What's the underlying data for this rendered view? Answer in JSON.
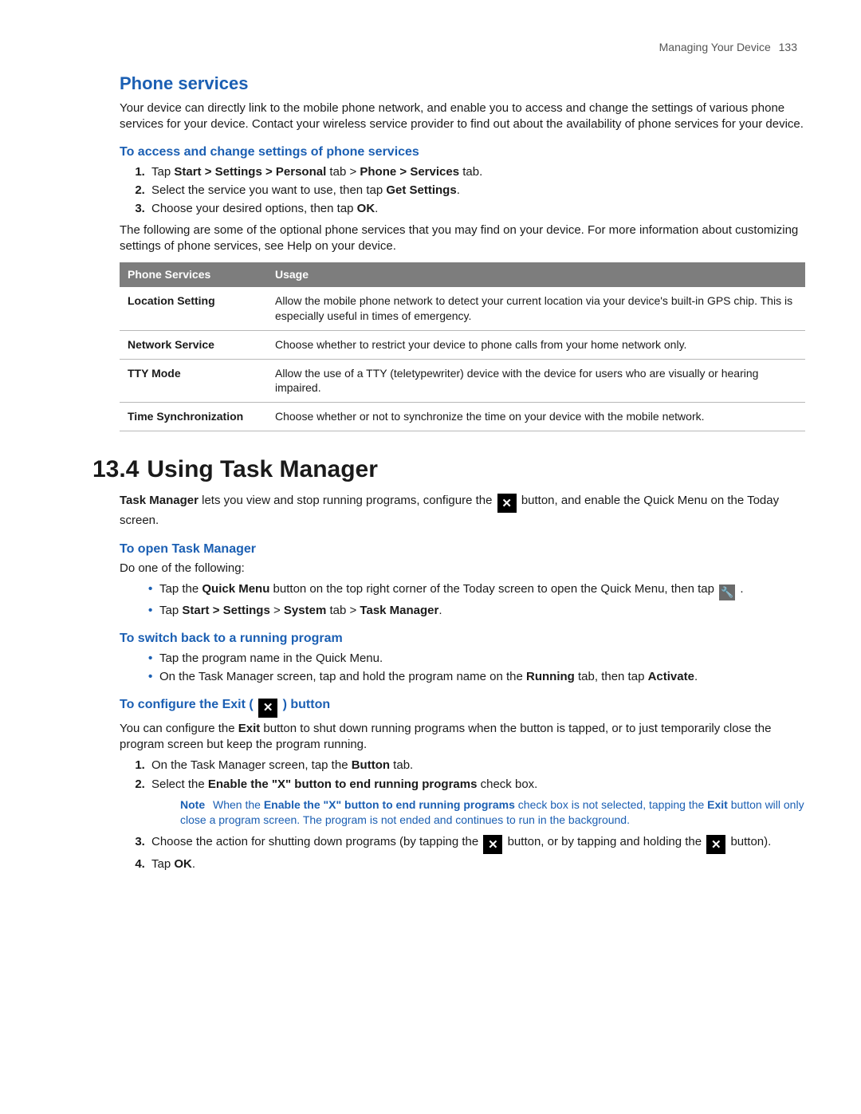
{
  "header": {
    "section": "Managing Your Device",
    "page": "133"
  },
  "phone": {
    "title": "Phone services",
    "intro": "Your device can directly link to the mobile phone network, and enable you to access and change the settings of various phone services for your device. Contact your wireless service provider to find out about the availability of phone services for your device.",
    "howto_title": "To access and change settings of phone services",
    "step1_pre": "Tap ",
    "step1_b1": "Start > Settings > Personal",
    "step1_mid": " tab > ",
    "step1_b2": "Phone > Services",
    "step1_post": " tab.",
    "step2_pre": "Select the service you want to use, then tap ",
    "step2_b": "Get Settings",
    "step2_post": ".",
    "step3_pre": "Choose your desired options, then tap ",
    "step3_b": "OK",
    "step3_post": ".",
    "note": "The following are some of the optional phone services that you may find on your device. For more information about customizing settings of phone services, see Help on your device.",
    "table": {
      "col1": "Phone Services",
      "col2": "Usage",
      "r1k": "Location Setting",
      "r1v": "Allow the mobile phone network to detect your current location via your device's built-in GPS chip. This is especially useful in times of emergency.",
      "r2k": "Network Service",
      "r2v": "Choose whether to restrict your device to phone calls from your home network only.",
      "r3k": "TTY Mode",
      "r3v": "Allow the use of a TTY (teletypewriter) device with the device for users who are visually or hearing impaired.",
      "r4k": "Time Synchronization",
      "r4v": "Choose whether or not to synchronize the time on your device with the mobile network."
    }
  },
  "tm": {
    "num": "13.4",
    "title": "Using Task Manager",
    "intro_b": "Task Manager",
    "intro_1": " lets you view and stop running programs, configure the ",
    "intro_2": " button, and enable the Quick Menu on the Today screen.",
    "open_title": "To open Task Manager",
    "open_intro": "Do one of the following:",
    "open_b1_pre": "Tap the ",
    "open_b1_b": "Quick Menu",
    "open_b1_mid": " button on the top right corner of the Today screen to open the Quick Menu, then tap ",
    "open_b1_post": " .",
    "open_b2_pre": "Tap ",
    "open_b2_b1": "Start > Settings",
    "open_b2_mid": " > ",
    "open_b2_b2": "System",
    "open_b2_mid2": " tab > ",
    "open_b2_b3": "Task Manager",
    "open_b2_post": ".",
    "switch_title": "To switch back to a running program",
    "switch_b1": "Tap the program name in the Quick Menu.",
    "switch_b2_pre": "On the Task Manager screen, tap and hold the program name on the ",
    "switch_b2_b1": "Running",
    "switch_b2_mid": " tab, then tap ",
    "switch_b2_b2": "Activate",
    "switch_b2_post": ".",
    "cfg_title_pre": "To configure the Exit ( ",
    "cfg_title_post": " ) button",
    "cfg_intro_pre": "You can configure the ",
    "cfg_intro_b": "Exit",
    "cfg_intro_post": " button to shut down running programs when the button is tapped, or to just temporarily close the program screen but keep the program running.",
    "cfg_s1_pre": "On the Task Manager screen, tap the ",
    "cfg_s1_b": "Button",
    "cfg_s1_post": " tab.",
    "cfg_s2_pre": "Select the ",
    "cfg_s2_b": "Enable the \"X\" button to end running programs",
    "cfg_s2_post": " check box.",
    "note_lbl": "Note",
    "note_pre": "When the ",
    "note_b1": "Enable the \"X\" button to end running programs",
    "note_mid": " check box is not selected, tapping the  ",
    "note_b2": "Exit",
    "note_post": " button will only close a program screen. The program is not ended and continues to run in the background.",
    "cfg_s3_pre": "Choose the action for shutting down programs (by tapping the ",
    "cfg_s3_mid": " button, or by tapping and holding the ",
    "cfg_s3_post": " button).",
    "cfg_s4_pre": "Tap ",
    "cfg_s4_b": "OK",
    "cfg_s4_post": "."
  }
}
